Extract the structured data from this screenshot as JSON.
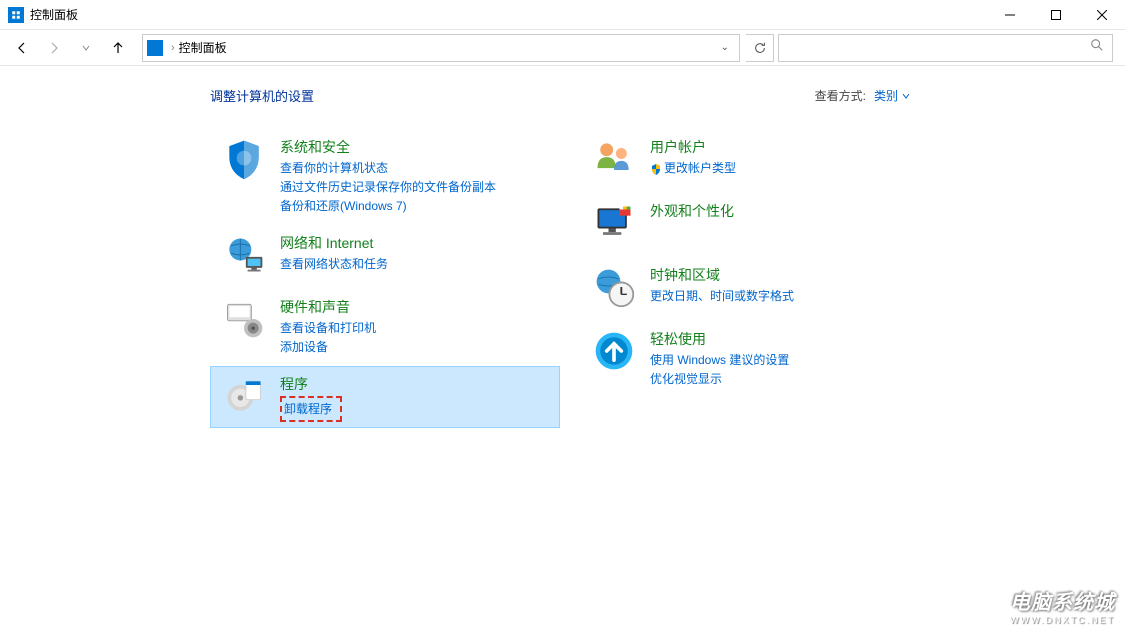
{
  "window": {
    "title": "控制面板"
  },
  "nav": {
    "address": "控制面板"
  },
  "header": {
    "title": "调整计算机的设置",
    "view_label": "查看方式:",
    "view_value": "类别"
  },
  "categories_left": [
    {
      "id": "system-security",
      "title": "系统和安全",
      "links": [
        "查看你的计算机状态",
        "通过文件历史记录保存你的文件备份副本",
        "备份和还原(Windows 7)"
      ]
    },
    {
      "id": "network-internet",
      "title": "网络和 Internet",
      "links": [
        "查看网络状态和任务"
      ]
    },
    {
      "id": "hardware-sound",
      "title": "硬件和声音",
      "links": [
        "查看设备和打印机",
        "添加设备"
      ]
    },
    {
      "id": "programs",
      "title": "程序",
      "links": [
        "卸载程序"
      ],
      "highlighted": true
    }
  ],
  "categories_right": [
    {
      "id": "user-accounts",
      "title": "用户帐户",
      "links": [
        "更改帐户类型"
      ],
      "uac": [
        true
      ]
    },
    {
      "id": "appearance",
      "title": "外观和个性化",
      "links": []
    },
    {
      "id": "clock-region",
      "title": "时钟和区域",
      "links": [
        "更改日期、时间或数字格式"
      ]
    },
    {
      "id": "ease-of-access",
      "title": "轻松使用",
      "links": [
        "使用 Windows 建议的设置",
        "优化视觉显示"
      ]
    }
  ],
  "watermark": {
    "text": "电脑系统城",
    "sub": "WWW.DNXTC.NET"
  }
}
